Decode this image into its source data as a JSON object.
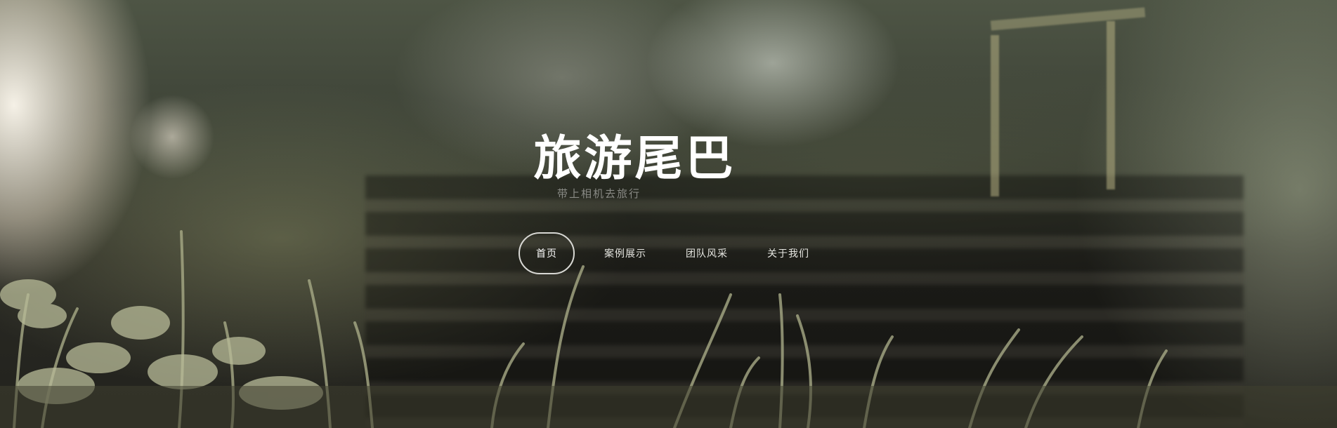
{
  "site": {
    "title": "旅游尾巴",
    "subtitle": "带上相机去旅行"
  },
  "nav": {
    "items": [
      {
        "label": "首页",
        "active": true
      },
      {
        "label": "案例展示",
        "active": false
      },
      {
        "label": "团队风采",
        "active": false
      },
      {
        "label": "关于我们",
        "active": false
      }
    ]
  },
  "hero": {
    "image": "blurred forest steps with grass in foreground",
    "accent_color": "#ffffff"
  }
}
